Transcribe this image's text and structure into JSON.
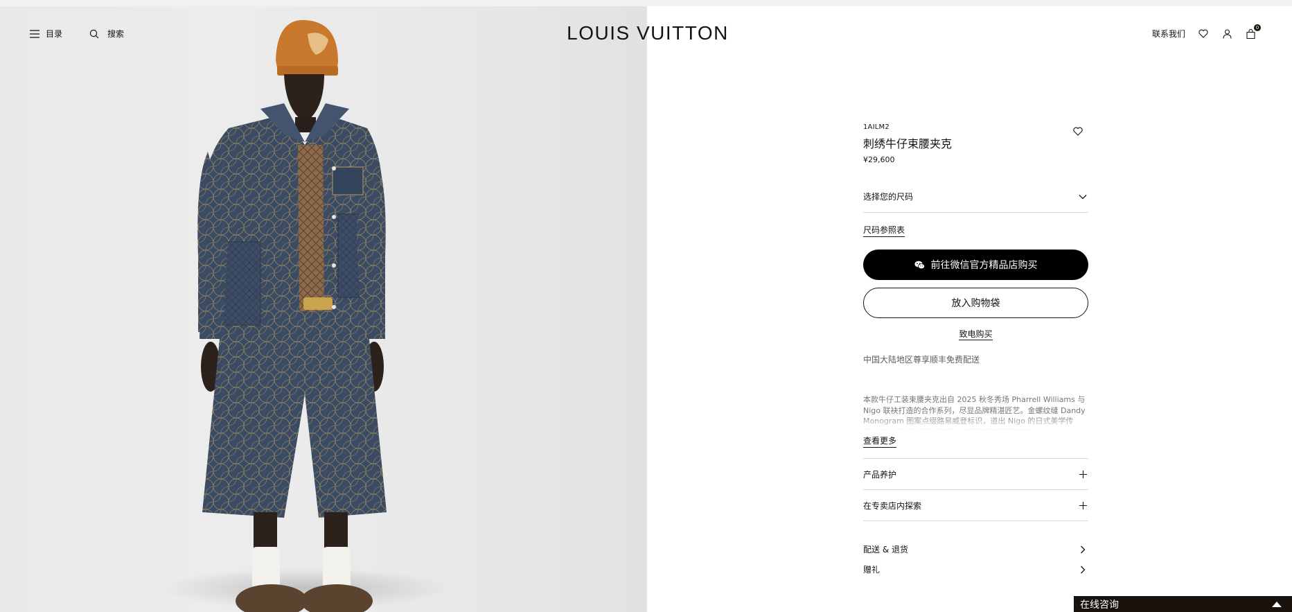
{
  "header": {
    "menu_label": "目录",
    "search_label": "搜索",
    "logo": "LOUIS VUITTON",
    "contact_label": "联系我们",
    "bag_count": "0"
  },
  "product": {
    "sku": "1AILM2",
    "title": "刺绣牛仔束腰夹克",
    "price": "¥29,600",
    "size_select_label": "选择您的尺码",
    "size_guide_label": "尺码参照表",
    "wechat_button_label": "前往微信官方精品店购买",
    "add_to_bag_label": "放入购物袋",
    "call_to_buy_label": "致电购买",
    "shipping_note": "中国大陆地区尊享顺丰免费配送",
    "description": "本款牛仔工装束腰夹克出自 2025 秋冬秀场 Pharrell Williams 与 Nigo 联袂打造的合作系列，尽显品牌精湛匠艺。金螺纹缝 Dandy Monogram 图案点缀路易威登标识，道出 Nigo 的日式美学传承。饰以织物表牌彰显其品。与同款短裤搭配相宜。",
    "read_more_label": "查看更多",
    "accordions": [
      "产品养护",
      "在专卖店内探索"
    ],
    "links": [
      "配送 & 退货",
      "赠礼"
    ]
  },
  "chat": {
    "label": "在线咨询"
  },
  "colors": {
    "text": "#19110b",
    "button_bg": "#000000",
    "divider": "#d9d9d9",
    "muted": "#767676",
    "beanie": "#c9792e",
    "denim": "#3a4a62",
    "vest": "#8a6a4a"
  }
}
